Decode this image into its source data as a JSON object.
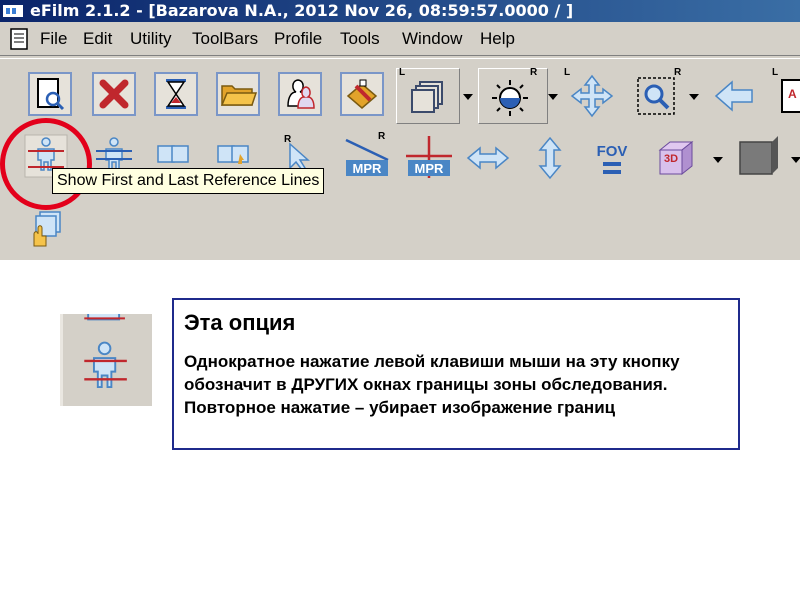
{
  "window": {
    "title": "eFilm 2.1.2 - [Bazarova N.A., 2012 Nov 26, 08:59:57.0000  /  ]"
  },
  "menubar": {
    "items": [
      "File",
      "Edit",
      "Utility",
      "ToolBars",
      "Profile",
      "Tools",
      "Window",
      "Help"
    ]
  },
  "toolbar": {
    "corner_labels": {
      "L": "L",
      "R": "R"
    },
    "mpr_label": "MPR",
    "fov_label": "FOV",
    "three_d_label": "3D",
    "tooltip": "Show First and Last Reference Lines"
  },
  "annotation": {
    "title": "Эта опция",
    "body": "Однократное нажатие левой клавиши мыши на эту кнопку  обозначит в ДРУГИХ окнах границы зоны обследования. Повторное нажатие – убирает изображение границ"
  },
  "colors": {
    "highlight_circle": "#e3001b",
    "callout_border": "#1f2a8c",
    "window_bg": "#d4d0c8",
    "titlebar": "#0a246a",
    "icon_blue": "#3b7fd6",
    "icon_red": "#c0272d"
  }
}
